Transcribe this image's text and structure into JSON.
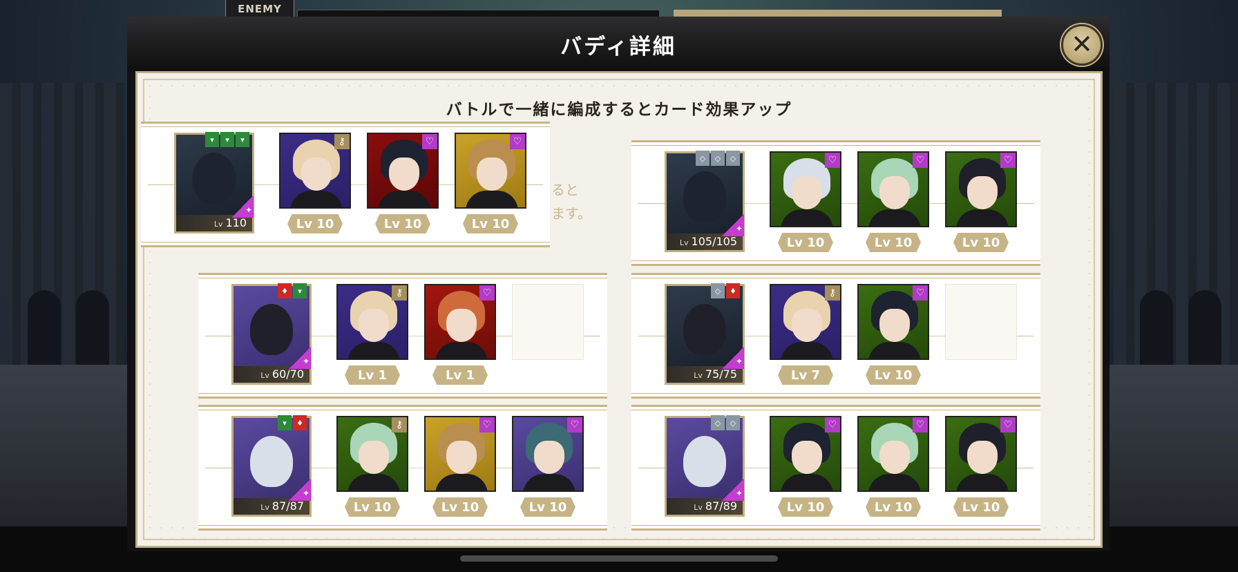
{
  "header": {
    "enemy_label": "ENEMY",
    "title": "バディ詳細",
    "close_label": "✕"
  },
  "panel": {
    "heading": "バトルで一緒に編成するとカード効果アップ",
    "obscured_text_1": "ると",
    "obscured_text_2": "ます。"
  },
  "groups": [
    {
      "lead_level": "110",
      "lead_badges": [
        "green",
        "green",
        "green"
      ],
      "buddies": [
        {
          "bg": "purple",
          "hair": "blonde",
          "icon": "key-icon",
          "level": "Lv 10"
        },
        {
          "bg": "red",
          "hair": "black",
          "icon": "heart-icon",
          "level": "Lv 10"
        },
        {
          "bg": "gold",
          "hair": "tan",
          "icon": "heart-icon",
          "level": "Lv 10"
        }
      ]
    },
    {
      "lead_level": "105/105",
      "lead_badges": [
        "grey",
        "grey",
        "grey"
      ],
      "buddies": [
        {
          "bg": "green",
          "hair": "silver",
          "icon": "heart-icon",
          "level": "Lv 10"
        },
        {
          "bg": "green",
          "hair": "mint",
          "icon": "heart-icon",
          "level": "Lv 10"
        },
        {
          "bg": "green",
          "hair": "dark",
          "icon": "heart-key-icons",
          "level": "Lv 10"
        }
      ]
    },
    {
      "lead_level": "60/70",
      "lead_badges": [
        "red",
        "green"
      ],
      "buddies": [
        {
          "bg": "purple",
          "hair": "blonde",
          "icon": "key-icon",
          "level": "Lv 1"
        },
        {
          "bg": "crimson",
          "hair": "ginger",
          "icon": "heart-icon",
          "level": "Lv 1"
        }
      ]
    },
    {
      "lead_level": "75/75",
      "lead_badges": [
        "grey",
        "red"
      ],
      "buddies": [
        {
          "bg": "purple",
          "hair": "blonde",
          "icon": "key-icon",
          "level": "Lv 7"
        },
        {
          "bg": "green",
          "hair": "black",
          "icon": "heart-icon",
          "level": "Lv 10"
        }
      ]
    },
    {
      "lead_level": "87/87",
      "lead_badges": [
        "green",
        "red"
      ],
      "buddies": [
        {
          "bg": "green",
          "hair": "mint",
          "icon": "key-icon",
          "level": "Lv 10"
        },
        {
          "bg": "gold",
          "hair": "tan",
          "icon": "heart-icon",
          "level": "Lv 10"
        },
        {
          "bg": "violet",
          "hair": "teal",
          "icon": "heart-icon",
          "level": "Lv 10"
        }
      ]
    },
    {
      "lead_level": "87/89",
      "lead_badges": [
        "grey",
        "grey"
      ],
      "buddies": [
        {
          "bg": "green",
          "hair": "black",
          "icon": "heart-icon",
          "level": "Lv 10"
        },
        {
          "bg": "green",
          "hair": "mint",
          "icon": "heart-icon",
          "level": "Lv 10"
        },
        {
          "bg": "green",
          "hair": "dark",
          "icon": "heart-key-icons",
          "level": "Lv 10"
        }
      ]
    }
  ],
  "lv_prefix": "Lv",
  "colors": {
    "accent_gold": "#c6b486",
    "heart_badge": "#b23bc7",
    "rarity": "#c43cd0"
  }
}
